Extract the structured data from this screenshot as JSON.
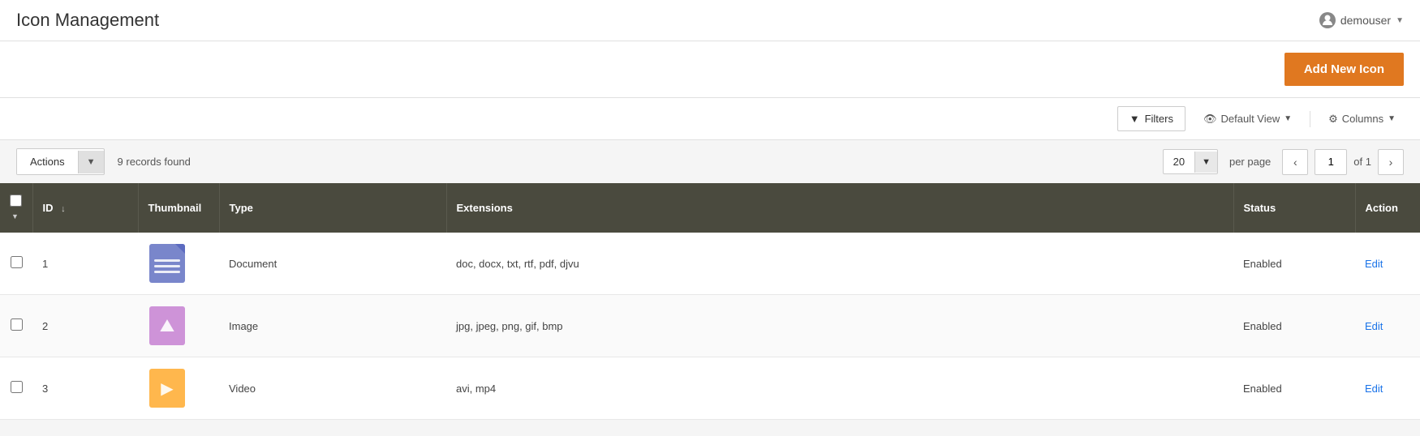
{
  "header": {
    "title": "Icon Management",
    "user": {
      "name": "demouser",
      "chevron": "▼"
    }
  },
  "toolbar": {
    "add_button_label": "Add New Icon"
  },
  "filter_bar": {
    "filters_label": "Filters",
    "view_label": "Default View",
    "columns_label": "Columns",
    "view_chevron": "▼",
    "columns_chevron": "▼"
  },
  "actions_bar": {
    "actions_label": "Actions",
    "actions_chevron": "▼",
    "records_found_count": "9",
    "records_found_label": "records found",
    "per_page": "20",
    "per_page_chevron": "▼",
    "per_page_label": "per page",
    "current_page": "1",
    "total_pages": "1",
    "of_label": "of"
  },
  "table": {
    "columns": [
      "",
      "ID",
      "Thumbnail",
      "Type",
      "Extensions",
      "Status",
      "Action"
    ],
    "rows": [
      {
        "id": "1",
        "thumbnail_type": "document",
        "type": "Document",
        "extensions": "doc, docx, txt, rtf, pdf, djvu",
        "status": "Enabled",
        "action": "Edit"
      },
      {
        "id": "2",
        "thumbnail_type": "image",
        "type": "Image",
        "extensions": "jpg, jpeg, png, gif, bmp",
        "status": "Enabled",
        "action": "Edit"
      },
      {
        "id": "3",
        "thumbnail_type": "video",
        "type": "Video",
        "extensions": "avi, mp4",
        "status": "Enabled",
        "action": "Edit"
      }
    ]
  },
  "colors": {
    "accent_orange": "#e07820",
    "header_dark": "#4a4a3e",
    "edit_blue": "#1a73e8"
  }
}
